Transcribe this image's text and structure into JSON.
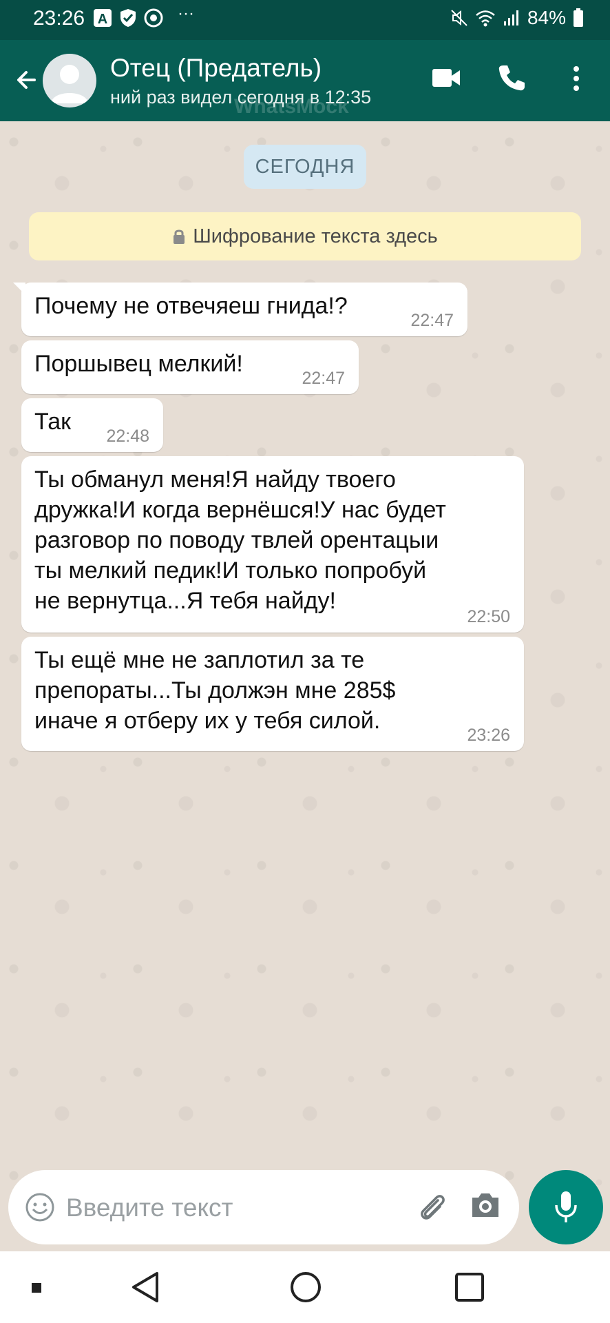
{
  "status_bar": {
    "time": "23:26",
    "dots": "···",
    "battery": "84%",
    "icons": [
      "a-icon",
      "shield-check-icon",
      "chrome-icon",
      "mute-icon",
      "wifi-icon",
      "signal-icon",
      "battery-icon"
    ]
  },
  "header": {
    "title": "Отец (Предатель)",
    "subtitle": "ний раз видел сегодня в 12:35",
    "watermark": "WhatsMock",
    "icons": [
      "back-arrow-icon",
      "video-call-icon",
      "phone-icon",
      "more-vert-icon"
    ]
  },
  "chat": {
    "date_label": "СЕГОДНЯ",
    "encryption_notice": "Шифрование текста здесь",
    "messages": [
      {
        "text": "Почему не отвечяеш гнида!?",
        "time": "22:47"
      },
      {
        "text": "Поршывец мелкий!",
        "time": "22:47"
      },
      {
        "text": "Так",
        "time": "22:48"
      },
      {
        "text": "Ты обманул меня!Я найду твоего\nдружка!И когда вернёшся!У нас будет\nразговор по поводу твлей орентацыи\nты мелкий педик!И только попробуй\nне вернутца...Я тебя найду!",
        "time": "22:50"
      },
      {
        "text": "Ты ещё мне не заплотил за те\nпрепораты...Ты должэн мне 285$\nиначе я отберу их у тебя силой.",
        "time": "23:26"
      }
    ]
  },
  "input": {
    "placeholder": "Введите текст",
    "icons": [
      "emoji-icon",
      "attach-icon",
      "camera-icon",
      "mic-icon"
    ]
  },
  "nav": {
    "icons": [
      "menu-square-icon",
      "back-triangle-icon",
      "home-circle-icon",
      "recents-square-icon"
    ]
  },
  "colors": {
    "header": "#075e54",
    "status_bar": "#064d45",
    "chat_bg": "#e6ddd4",
    "accent": "#00897b",
    "bubble": "#ffffff"
  }
}
